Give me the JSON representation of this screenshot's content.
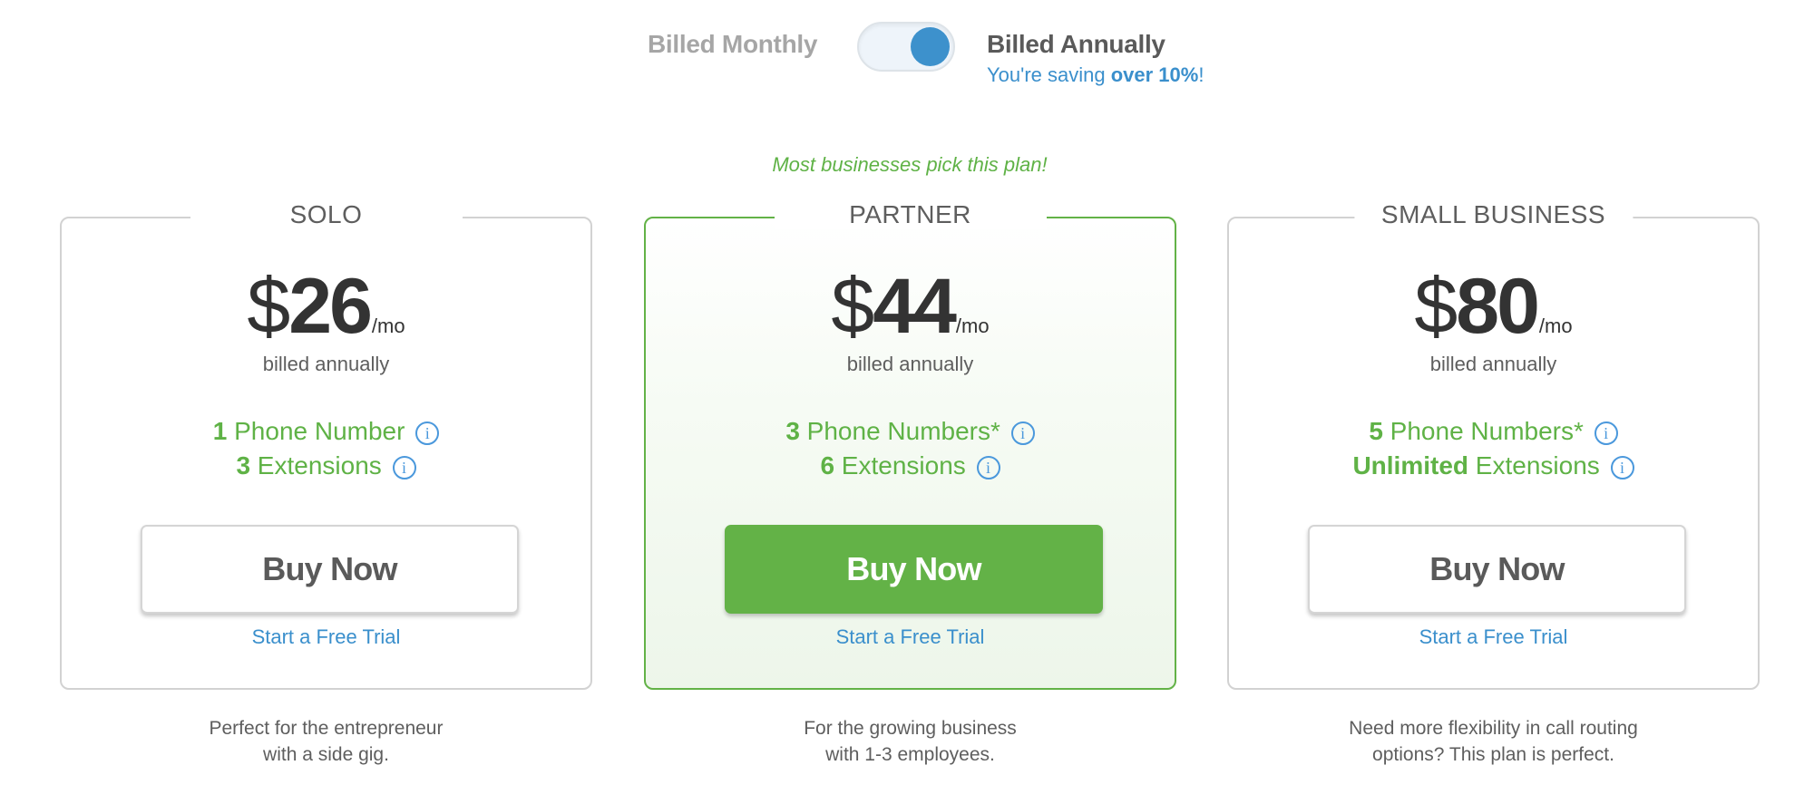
{
  "billing": {
    "monthly_label": "Billed Monthly",
    "annually_label": "Billed Annually",
    "selected": "annually",
    "saving_prefix": "You're saving ",
    "saving_amount": "over 10%",
    "saving_suffix": "!",
    "accent_color": "#3d91cc"
  },
  "popular_note": "Most businesses pick this plan!",
  "plans": [
    {
      "name": "SOLO",
      "currency": "$",
      "price": "26",
      "per": "/mo",
      "billed": "billed annually",
      "features": [
        {
          "count": "1",
          "label": " Phone Number",
          "info": "i"
        },
        {
          "count": "3",
          "label": " Extensions",
          "info": "i"
        }
      ],
      "buy_label": "Buy Now",
      "trial_label": "Start a Free Trial",
      "description": [
        "Perfect for the entrepreneur",
        "with a side gig."
      ],
      "featured": false
    },
    {
      "name": "PARTNER",
      "currency": "$",
      "price": "44",
      "per": "/mo",
      "billed": "billed annually",
      "features": [
        {
          "count": "3",
          "label": " Phone Numbers*",
          "info": "i"
        },
        {
          "count": "6",
          "label": " Extensions",
          "info": "i"
        }
      ],
      "buy_label": "Buy Now",
      "trial_label": "Start a Free Trial",
      "description": [
        "For the growing business",
        "with 1-3 employees."
      ],
      "featured": true
    },
    {
      "name": "SMALL BUSINESS",
      "currency": "$",
      "price": "80",
      "per": "/mo",
      "billed": "billed annually",
      "features": [
        {
          "count": "5",
          "label": " Phone Numbers*",
          "info": "i"
        },
        {
          "count": "Unlimited",
          "label": " Extensions",
          "info": "i"
        }
      ],
      "buy_label": "Buy Now",
      "trial_label": "Start a Free Trial",
      "description": [
        "Need more flexibility in call routing",
        "options? This plan is perfect."
      ],
      "featured": false
    }
  ],
  "colors": {
    "green": "#63b247",
    "link_blue": "#3a8fcc",
    "text_dark": "#333333",
    "text_muted": "#5e5e5e"
  }
}
